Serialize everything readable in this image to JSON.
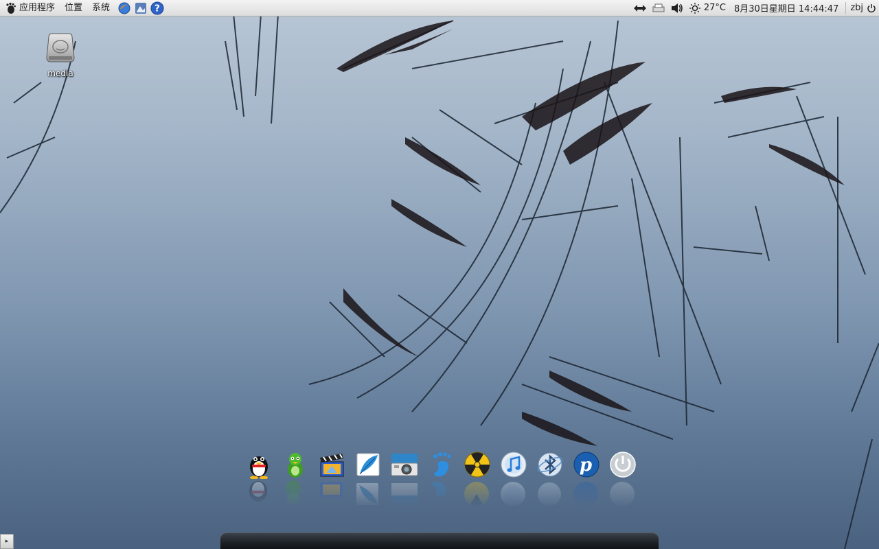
{
  "top_panel": {
    "menus": [
      "应用程序",
      "位置",
      "系统"
    ],
    "launchers": [
      "web-browser-icon",
      "photo-manager-icon",
      "help-icon"
    ],
    "tray": {
      "network": "network-icon",
      "printer": "printer-icon",
      "volume": "volume-icon",
      "weather_icon": "sun-icon",
      "temperature": "27°C",
      "datetime": "8月30日星期日 14:44:47",
      "user": "zbj",
      "power": "power-icon"
    }
  },
  "desktop": {
    "icons": [
      {
        "label": "media",
        "icon": "hard-drive-icon"
      }
    ]
  },
  "dock": {
    "items": [
      {
        "name": "qq-penguin",
        "icon": "penguin-icon",
        "color": "#e02020"
      },
      {
        "name": "green-chat",
        "icon": "green-mascot-icon",
        "color": "#4caf2b"
      },
      {
        "name": "movie-player",
        "icon": "clapperboard-icon",
        "color": "#3a6fd0"
      },
      {
        "name": "text-editor",
        "icon": "feather-icon",
        "color": "#2a8fd8"
      },
      {
        "name": "photo-viewer",
        "icon": "camera-icon",
        "color": "#2e86c8"
      },
      {
        "name": "gnome-foot",
        "icon": "foot-icon",
        "color": "#3aa0e8"
      },
      {
        "name": "disc-burner",
        "icon": "radiation-icon",
        "color": "#f2c418"
      },
      {
        "name": "music-player",
        "icon": "music-note-icon",
        "color": "#4aa8e8"
      },
      {
        "name": "bluetooth",
        "icon": "bluetooth-icon",
        "color": "#5b8fc8"
      },
      {
        "name": "pidgin",
        "icon": "letter-p-icon",
        "color": "#1a5fb0"
      },
      {
        "name": "shutdown",
        "icon": "power-button-icon",
        "color": "#c8c8c8"
      }
    ]
  }
}
